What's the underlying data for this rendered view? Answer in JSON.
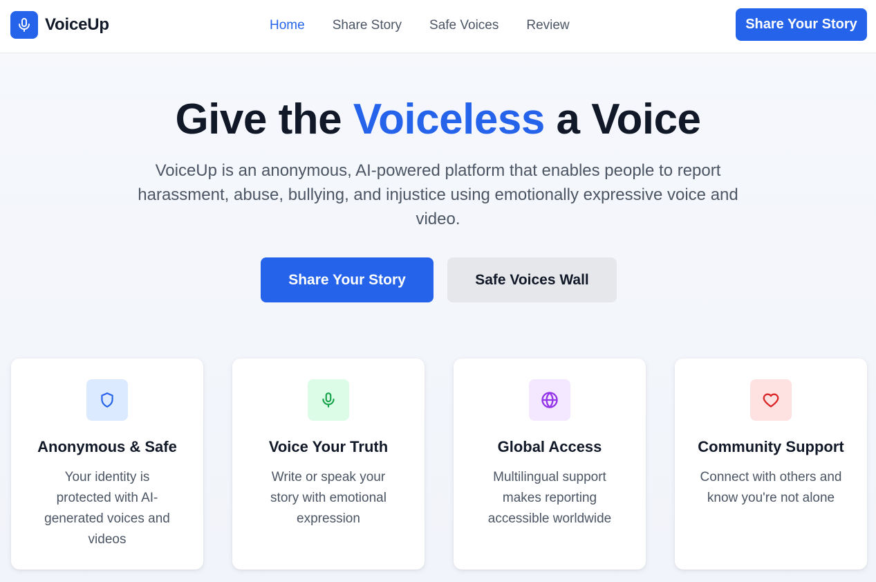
{
  "header": {
    "brand": "VoiceUp",
    "nav": [
      {
        "label": "Home",
        "active": true
      },
      {
        "label": "Share Story",
        "active": false
      },
      {
        "label": "Safe Voices",
        "active": false
      },
      {
        "label": "Review",
        "active": false
      }
    ],
    "cta_label": "Share Your Story"
  },
  "hero": {
    "title_before": "Give the ",
    "title_accent": "Voiceless",
    "title_after": " a Voice",
    "subtitle": "VoiceUp is an anonymous, AI-powered platform that enables people to report harassment, abuse, bullying, and injustice using emotionally expressive voice and video.",
    "primary_button": "Share Your Story",
    "secondary_button": "Safe Voices Wall"
  },
  "features": [
    {
      "icon": "shield-icon",
      "title": "Anonymous & Safe",
      "description": "Your identity is protected with AI-generated voices and videos",
      "icon_bg": "#dbeafe",
      "icon_color": "#2563eb"
    },
    {
      "icon": "microphone-icon",
      "title": "Voice Your Truth",
      "description": "Write or speak your story with emotional expression",
      "icon_bg": "#dcfce7",
      "icon_color": "#16a34a"
    },
    {
      "icon": "globe-icon",
      "title": "Global Access",
      "description": "Multilingual support makes reporting accessible worldwide",
      "icon_bg": "#f3e8ff",
      "icon_color": "#9333ea"
    },
    {
      "icon": "heart-icon",
      "title": "Community Support",
      "description": "Connect with others and know you're not alone",
      "icon_bg": "#fee2e2",
      "icon_color": "#dc2626"
    }
  ],
  "colors": {
    "accent": "#2563eb",
    "text_primary": "#111827",
    "text_secondary": "#4b5563"
  }
}
